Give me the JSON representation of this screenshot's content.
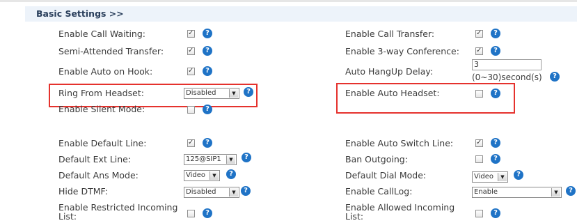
{
  "section": {
    "title": "Basic Settings >>"
  },
  "help_glyph": "?",
  "dropdown_glyph": "▼",
  "left": {
    "call_waiting": {
      "label": "Enable Call Waiting:",
      "checked": true
    },
    "semi_attended": {
      "label": "Semi-Attended Transfer:",
      "checked": true
    },
    "auto_on_hook": {
      "label": "Enable Auto on Hook:",
      "checked": true
    },
    "ring_from_headset": {
      "label": "Ring From Headset:",
      "value": "Disabled"
    },
    "silent_mode": {
      "label": "Enable Silent Mode:",
      "checked": false
    },
    "default_line": {
      "label": "Enable Default Line:",
      "checked": true
    },
    "default_ext_line": {
      "label": "Default Ext Line:",
      "value": "125@SIP1"
    },
    "default_ans_mode": {
      "label": "Default Ans Mode:",
      "value": "Video"
    },
    "hide_dtmf": {
      "label": "Hide DTMF:",
      "value": "Disabled"
    },
    "restricted_incoming": {
      "label_line1": "Enable Restricted Incoming",
      "label_line2": "List:",
      "checked": false
    }
  },
  "right": {
    "call_transfer": {
      "label": "Enable Call Transfer:",
      "checked": true
    },
    "three_way": {
      "label": "Enable 3-way Conference:",
      "checked": true
    },
    "auto_hangup": {
      "label": "Auto HangUp Delay:",
      "value": "3",
      "hint": "(0~30)second(s)"
    },
    "auto_headset": {
      "label": "Enable Auto Headset:",
      "checked": false
    },
    "auto_switch_line": {
      "label": "Enable Auto Switch Line:",
      "checked": true
    },
    "ban_outgoing": {
      "label": "Ban Outgoing:",
      "checked": false
    },
    "default_dial_mode": {
      "label": "Default Dial Mode:",
      "value": "Video"
    },
    "call_log": {
      "label": "Enable CallLog:",
      "value": "Enable"
    },
    "allowed_incoming": {
      "label_line1": "Enable Allowed Incoming",
      "label_line2": "List:",
      "checked": false
    }
  },
  "colors": {
    "highlight": "#e5322d",
    "help": "#1f73c6",
    "header_bg": "#edf3fa"
  }
}
